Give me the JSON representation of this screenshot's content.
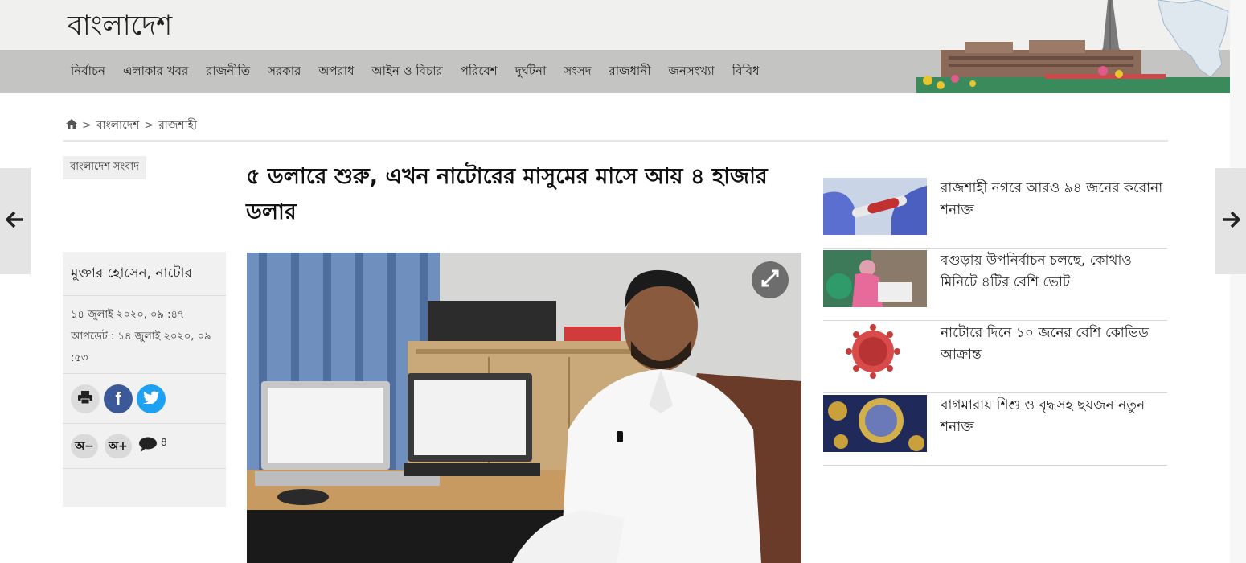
{
  "site": {
    "title": "বাংলাদেশ"
  },
  "nav": {
    "items": [
      "নির্বাচন",
      "এলাকার খবর",
      "রাজনীতি",
      "সরকার",
      "অপরাধ",
      "আইন ও বিচার",
      "পরিবেশ",
      "দুর্ঘটনা",
      "সংসদ",
      "রাজধানী",
      "জনসংখ্যা",
      "বিবিধ"
    ]
  },
  "breadcrumb": {
    "home_icon": "home-icon",
    "level1": "বাংলাদেশ",
    "level2": "রাজশাহী",
    "separator": ">"
  },
  "article": {
    "category": "বাংলাদেশ সংবাদ",
    "headline": "৫ ডলারে শুরু, এখন নাটোরের মাসুমের মাসে আয় ৪ হাজার ডলার",
    "author": "মুক্তার হোসেন, নাটোর",
    "published": "১৪ জুলাই ২০২০, ০৯ :৪৭",
    "updated": "আপডেট : ১৪ জুলাই ২০২০, ০৯ :৫৩",
    "font_decrease": "অ−",
    "font_increase": "অ+",
    "comment_count": "8"
  },
  "related": [
    {
      "title": "রাজশাহী নগরে আরও ৯৪ জনের করোনা শনাক্ত"
    },
    {
      "title": "বগুড়ায় উপনির্বাচন চলছে, কোথাও মিনিটে ৪টির বেশি ভোট"
    },
    {
      "title": "নাটোরে দিনে ১০ জনের বেশি কোভিড আক্রান্ত"
    },
    {
      "title": "বাগমারায় শিশু ও বৃদ্ধসহ ছয়জন নতুন শনাক্ত"
    }
  ],
  "colors": {
    "nav_bg": "#c4c4c2",
    "facebook": "#3b5998",
    "twitter": "#1da1f2"
  }
}
